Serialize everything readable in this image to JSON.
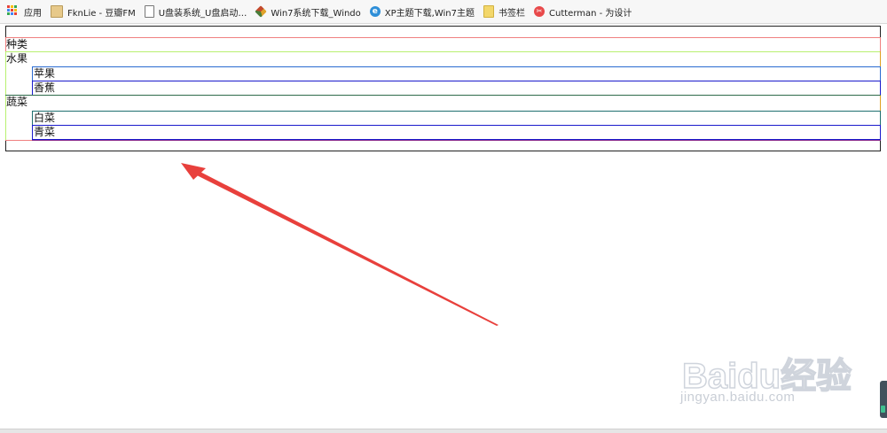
{
  "bookmarks": [
    {
      "label": "应用",
      "icon": "apps-grid-icon"
    },
    {
      "label": "FknLie - 豆瓣FM",
      "icon": "image-icon"
    },
    {
      "label": "U盘装系统_U盘启动…",
      "icon": "document-icon"
    },
    {
      "label": "Win7系统下载_Windo",
      "icon": "cube-icon"
    },
    {
      "label": "XP主题下载,Win7主题",
      "icon": "ie-icon"
    },
    {
      "label": "书签栏",
      "icon": "folder-icon"
    },
    {
      "label": "Cutterman - 为设计",
      "icon": "cutterman-icon"
    }
  ],
  "tree": {
    "root": "种类",
    "groups": [
      {
        "label": "水果",
        "items": [
          "苹果",
          "香蕉"
        ]
      },
      {
        "label": "蔬菜",
        "items": [
          "白菜",
          "青菜"
        ]
      }
    ]
  },
  "colors": {
    "outer": "#222222",
    "root_border": "#f08080",
    "group_border": "#b8f070",
    "item_border": "#1a1acc",
    "item_top_border": "#2a6ad0",
    "arrow": "#e8403c",
    "right_edge": "#8a2a8a"
  },
  "watermark": {
    "brand": "Baidu经验",
    "url": "jingyan.baidu.com"
  }
}
